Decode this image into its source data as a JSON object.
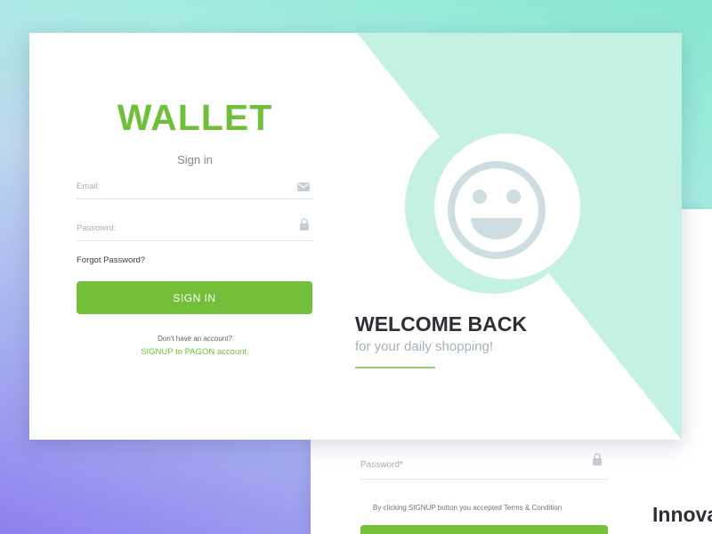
{
  "theme": {
    "accent": "#74bf3a",
    "mint": "#c5f0e4",
    "smiley": "#cddde2"
  },
  "login": {
    "brand": "WALLET",
    "subtitle": "Sign in",
    "email_placeholder": "Email:",
    "email_icon": "mail-icon",
    "password_placeholder": "Passowrd:",
    "password_icon": "lock-icon",
    "forgot_label": "Forgot Password?",
    "signin_label": "SIGN IN",
    "no_account_text": "Don't have an account?",
    "signup_link": "SIGNUP to PAGON account."
  },
  "welcome": {
    "illustration_icon": "smiley-face-icon",
    "title": "WELCOME BACK",
    "tagline": "for your daily shopping!"
  },
  "signup_card": {
    "password_placeholder": "Password*",
    "password_icon": "lock-icon",
    "terms_text": "By clicking SIGNUP button you accepted Terms & Condition",
    "heading_fragment": "Innova"
  }
}
